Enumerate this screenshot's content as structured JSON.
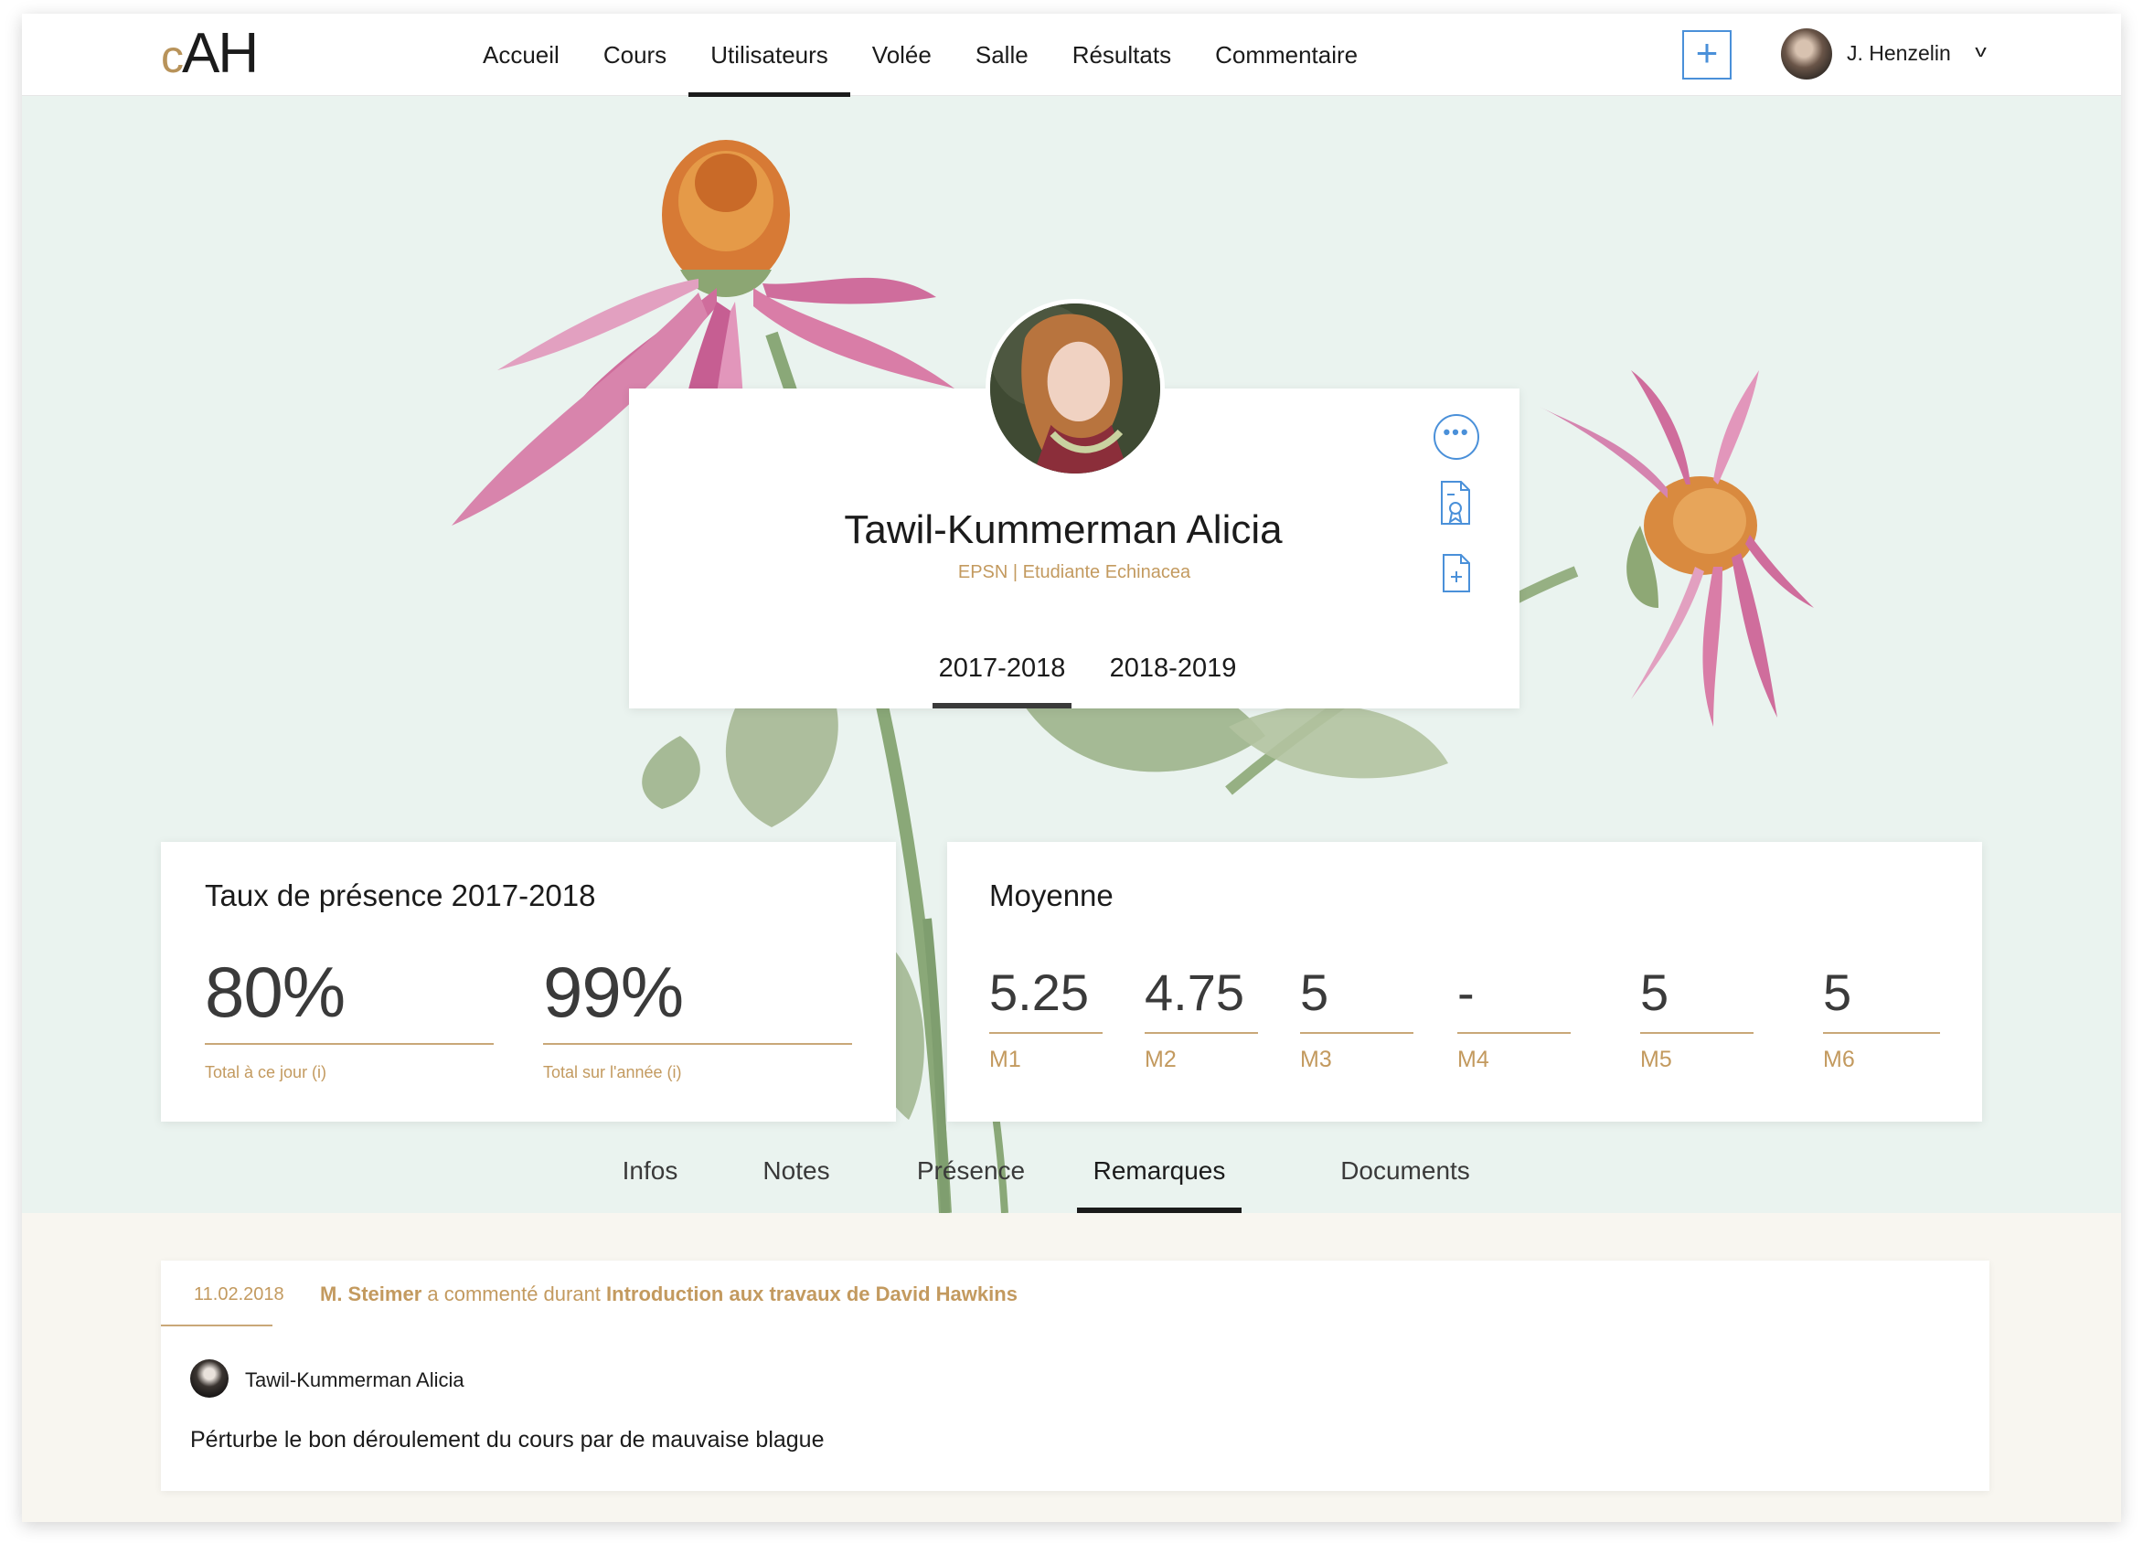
{
  "brand": {
    "logo_c": "c",
    "logo_rest": "AH",
    "accent": "#b8935a"
  },
  "nav": {
    "items": [
      {
        "label": "Accueil",
        "active": false
      },
      {
        "label": "Cours",
        "active": false
      },
      {
        "label": "Utilisateurs",
        "active": true
      },
      {
        "label": "Volée",
        "active": false
      },
      {
        "label": "Salle",
        "active": false
      },
      {
        "label": "Résultats",
        "active": false
      },
      {
        "label": "Commentaire",
        "active": false
      }
    ],
    "add_label": "+",
    "user_name": "J. Henzelin",
    "user_caret": "v"
  },
  "profile": {
    "name": "Tawil-Kummerman Alicia",
    "subtitle": "EPSN | Etudiante Echinacea",
    "more_label": "•••",
    "icons": [
      "more-icon",
      "certificate-icon",
      "document-add-icon"
    ],
    "year_tabs": [
      {
        "label": "2017-2018",
        "active": true
      },
      {
        "label": "2018-2019",
        "active": false
      }
    ]
  },
  "presence": {
    "title": "Taux de présence 2017-2018",
    "stats": [
      {
        "value": "80%",
        "label": "Total à ce jour (i)"
      },
      {
        "value": "99%",
        "label": "Total sur l'année (i)"
      }
    ]
  },
  "moyenne": {
    "title": "Moyenne",
    "stats": [
      {
        "value": "5.25",
        "label": "M1"
      },
      {
        "value": "4.75",
        "label": "M2"
      },
      {
        "value": "5",
        "label": "M3"
      },
      {
        "value": "-",
        "label": "M4"
      },
      {
        "value": "5",
        "label": "M5"
      },
      {
        "value": "5",
        "label": "M6"
      }
    ]
  },
  "section_tabs": [
    {
      "label": "Infos",
      "active": false
    },
    {
      "label": "Notes",
      "active": false
    },
    {
      "label": "Présence",
      "active": false
    },
    {
      "label": "Remarques",
      "active": true
    },
    {
      "label": "Documents",
      "active": false
    }
  ],
  "remark": {
    "date": "11.02.2018",
    "author_teacher": "M. Steimer",
    "verb": " a commenté durant ",
    "course": "Introduction aux travaux de David Hawkins",
    "student": "Tawil-Kummerman Alicia",
    "text": "Pérturbe le bon déroulement du cours par de mauvaise blague"
  },
  "colors": {
    "accent_gold": "#c39a5f",
    "action_blue": "#4a90d9",
    "hero_bg": "#eaf3ef",
    "lower_bg": "#f8f6f0"
  }
}
